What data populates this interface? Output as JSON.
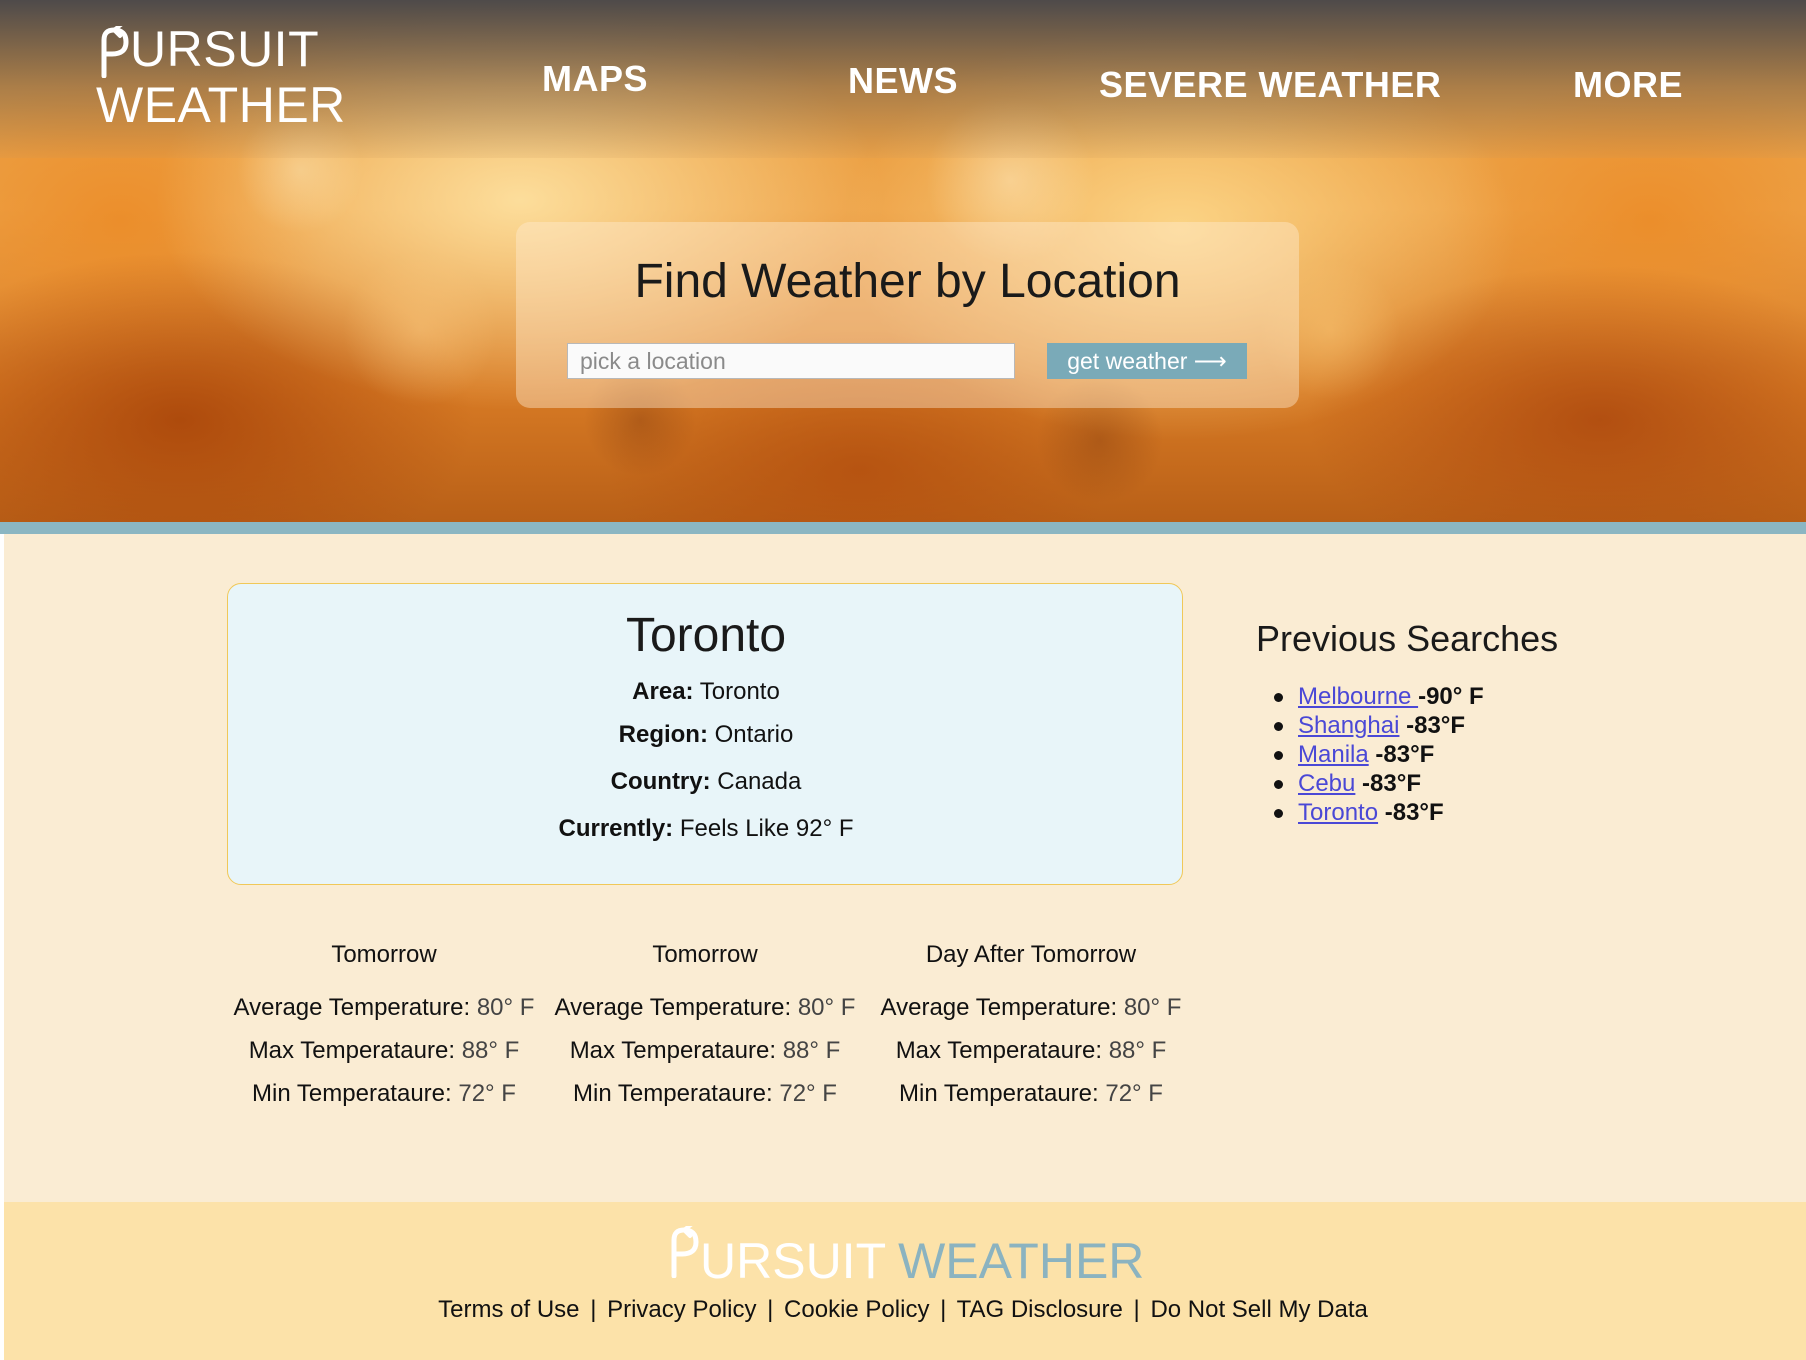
{
  "header": {
    "logo": {
      "line1": "URSUIT",
      "line2": "WEATHER"
    },
    "nav": [
      "MAPS",
      "NEWS",
      "SEVERE WEATHER",
      "MORE"
    ]
  },
  "search": {
    "title": "Find Weather by Location",
    "placeholder": "pick a location",
    "button_label": "get weather ⟶"
  },
  "city": {
    "name": "Toronto",
    "area_label": "Area:",
    "area": "Toronto",
    "region_label": "Region:",
    "region": "Ontario",
    "country_label": "Country:",
    "country": "Canada",
    "currently_label": "Currently:",
    "currently": "Feels Like 92° F"
  },
  "previous": {
    "title": "Previous Searches",
    "items": [
      {
        "city": "Melbourne ",
        "temp": "-90° F"
      },
      {
        "city": "Shanghai",
        "temp": "-83°F"
      },
      {
        "city": "Manila",
        "temp": "-83°F"
      },
      {
        "city": "Cebu",
        "temp": "-83°F"
      },
      {
        "city": "Toronto",
        "temp": "-83°F"
      }
    ]
  },
  "forecast": {
    "avg_label": "Average Temperature",
    "max_label": "Max Temperataure",
    "min_label": "Min Temperataure",
    "days": [
      {
        "day": "Tomorrow",
        "avg": "80° F",
        "max": "88° F",
        "min": "72° F"
      },
      {
        "day": "Tomorrow",
        "avg": "80° F",
        "max": "88° F",
        "min": "72° F"
      },
      {
        "day": "Day After Tomorrow",
        "avg": "80° F",
        "max": "88° F",
        "min": "72° F"
      }
    ]
  },
  "footer": {
    "logo_pursuit": "URSUIT",
    "logo_weather": "WEATHER",
    "links": [
      "Terms of Use",
      "Privacy Policy",
      "Cookie Policy",
      "TAG Disclosure",
      "Do Not Sell My Data"
    ],
    "separator": "|"
  },
  "colors": {
    "accent": "#7aaab8",
    "stripe": "#8bb6c2",
    "main_bg": "#faecd3",
    "card_bg": "#e8f5f9",
    "card_border": "#f0c858",
    "footer_bg": "#fce2a9",
    "link": "#4a48d6"
  }
}
